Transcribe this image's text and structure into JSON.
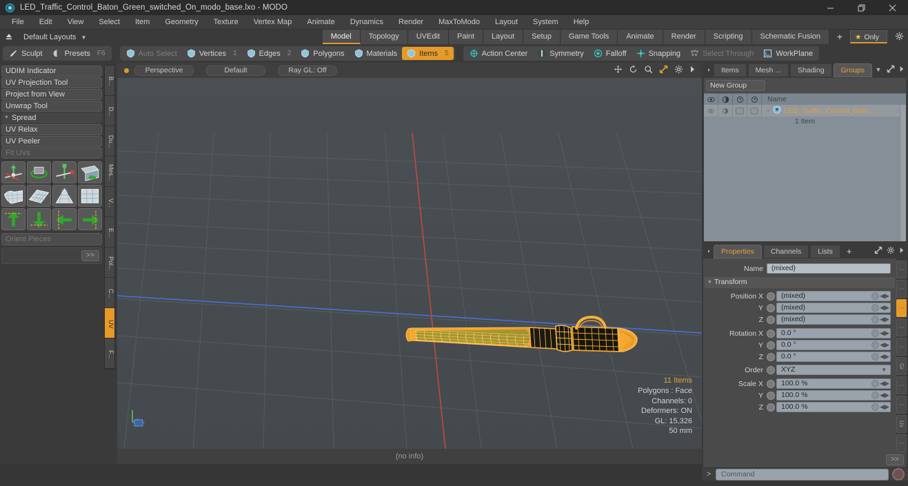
{
  "window": {
    "title": "LED_Traffic_Control_Baton_Green_switched_On_modo_base.lxo - MODO",
    "minimize": "—",
    "maximize": "❐",
    "close": "✕"
  },
  "menubar": [
    "File",
    "Edit",
    "View",
    "Select",
    "Item",
    "Geometry",
    "Texture",
    "Vertex Map",
    "Animate",
    "Dynamics",
    "Render",
    "MaxToModo",
    "Layout",
    "System",
    "Help"
  ],
  "layoutbar": {
    "layouts_label": "Default Layouts",
    "tabs": [
      "Model",
      "Topology",
      "UVEdit",
      "Paint",
      "Layout",
      "Setup",
      "Game Tools",
      "Animate",
      "Render",
      "Scripting",
      "Schematic Fusion"
    ],
    "selected_tab": "Model",
    "plus": "+",
    "only_label": "Only",
    "star": "★"
  },
  "modebar": {
    "group1": [
      {
        "label": "Sculpt",
        "icon": "brush-icon",
        "state": "normal",
        "num": ""
      },
      {
        "label": "Presets",
        "icon": "sphere-icon",
        "state": "normal",
        "num": "F6"
      }
    ],
    "group2": [
      {
        "label": "Auto Select",
        "icon": "shield-icon",
        "state": "dim",
        "num": ""
      },
      {
        "label": "Vertices",
        "icon": "shield-icon",
        "state": "normal",
        "num": "1"
      },
      {
        "label": "Edges",
        "icon": "shield-icon",
        "state": "normal",
        "num": "2"
      },
      {
        "label": "Polygons",
        "icon": "shield-icon",
        "state": "normal",
        "num": ""
      },
      {
        "label": "Materials",
        "icon": "shield-icon",
        "state": "normal",
        "num": ""
      },
      {
        "label": "Items",
        "icon": "shield-icon",
        "state": "on",
        "num": "5"
      }
    ],
    "group3": [
      {
        "label": "Action Center",
        "icon": "target-icon",
        "state": "normal",
        "num": ""
      },
      {
        "label": "Symmetry",
        "icon": "bars-icon",
        "state": "normal",
        "num": ""
      },
      {
        "label": "Falloff",
        "icon": "circle-icon",
        "state": "normal",
        "num": ""
      },
      {
        "label": "Snapping",
        "icon": "crosshair-icon",
        "state": "normal",
        "num": ""
      },
      {
        "label": "Select Through",
        "icon": "dots-icon",
        "state": "dim",
        "num": ""
      },
      {
        "label": "WorkPlane",
        "icon": "plane-icon",
        "state": "normal",
        "num": ""
      }
    ]
  },
  "left_panel": {
    "rows": [
      {
        "label": "UDIM Indicator",
        "type": "button",
        "state": "normal"
      },
      {
        "label": "UV Projection Tool",
        "type": "button",
        "state": "normal"
      },
      {
        "label": "Project from View",
        "type": "button",
        "state": "normal"
      },
      {
        "label": "Unwrap Tool",
        "type": "button",
        "state": "normal"
      },
      {
        "label": "Spread",
        "type": "group",
        "state": "normal"
      },
      {
        "label": "UV Relax",
        "type": "button",
        "state": "normal"
      },
      {
        "label": "UV Peeler",
        "type": "button",
        "state": "normal"
      },
      {
        "label": "Fit UVs",
        "type": "button",
        "state": "dim"
      }
    ],
    "tool_grid": [
      [
        "uv-move-icon",
        "uv-rotate-icon",
        "uv-scale-icon",
        "uv-flip-icon"
      ],
      [
        "uv-fit-icon",
        "uv-grid-icon",
        "uv-taper-icon",
        "uv-square-icon"
      ],
      [
        "uv-up-icon",
        "uv-down-icon",
        "uv-left-icon",
        "uv-right-icon"
      ]
    ],
    "orient_label": "Orient Pieces",
    "more_label": ">>",
    "vtabs": [
      {
        "label": "B...",
        "on": false
      },
      {
        "label": "D...",
        "on": false
      },
      {
        "label": "Du...",
        "on": false
      },
      {
        "label": "Mes...",
        "on": false
      },
      {
        "label": "V...",
        "on": false
      },
      {
        "label": "E...",
        "on": false
      },
      {
        "label": "Pol...",
        "on": false
      },
      {
        "label": "C...",
        "on": false
      },
      {
        "label": "UV",
        "on": true
      },
      {
        "label": "F...",
        "on": false
      }
    ]
  },
  "viewport": {
    "pills": [
      "Perspective",
      "Default",
      "Ray GL: Off"
    ],
    "nav_icons": [
      "pan-icon",
      "rotate-icon",
      "zoom-icon",
      "fit-icon",
      "settings-icon",
      "more-icon"
    ],
    "info": {
      "items": "11 Items",
      "polygons": "Polygons : Face",
      "channels": "Channels: 0",
      "deformers": "Deformers: ON",
      "gl": "GL: 15,326",
      "scale": "50 mm"
    },
    "status": "(no info)"
  },
  "right_panel": {
    "tabs": [
      {
        "label": "Items",
        "sel": false
      },
      {
        "label": "Mesh ...",
        "sel": false
      },
      {
        "label": "Shading",
        "sel": false
      },
      {
        "label": "Groups",
        "sel": true
      }
    ],
    "tab_caret": "▼",
    "new_group_label": "New Group",
    "list_header": {
      "cols": [
        "eye-icon",
        "shade-icon",
        "lock-icon",
        "render-icon"
      ],
      "name": "Name"
    },
    "list_rows": [
      {
        "name": "LED_Traffic_Control_Bato ...",
        "sub": "1 Item",
        "expander": "+"
      }
    ]
  },
  "properties": {
    "tabs": [
      {
        "label": "Properties",
        "sel": true
      },
      {
        "label": "Channels",
        "sel": false
      },
      {
        "label": "Lists",
        "sel": false
      },
      {
        "label": "+",
        "sel": false
      }
    ],
    "name_label": "Name",
    "name_value": "(mixed)",
    "transform_label": "Transform",
    "fields": [
      {
        "label": "Position X",
        "value": "(mixed)",
        "type": "num"
      },
      {
        "label": "Y",
        "value": "(mixed)",
        "type": "num"
      },
      {
        "label": "Z",
        "value": "(mixed)",
        "type": "num"
      },
      {
        "label": "Rotation X",
        "value": "0.0 °",
        "type": "num"
      },
      {
        "label": "Y",
        "value": "0.0 °",
        "type": "num"
      },
      {
        "label": "Z",
        "value": "0.0 °",
        "type": "num"
      },
      {
        "label": "Order",
        "value": "XYZ",
        "type": "dropdown"
      },
      {
        "label": "Scale X",
        "value": "100.0 %",
        "type": "num"
      },
      {
        "label": "Y",
        "value": "100.0 %",
        "type": "num"
      },
      {
        "label": "Z",
        "value": "100.0 %",
        "type": "num"
      }
    ],
    "more_label": ">>",
    "vtabs": [
      {
        "label": "",
        "on": false
      },
      {
        "label": "",
        "on": false
      },
      {
        "label": "",
        "on": true
      },
      {
        "label": "",
        "on": false
      },
      {
        "label": "",
        "on": false
      },
      {
        "label": "Gr",
        "on": false
      },
      {
        "label": "",
        "on": false
      },
      {
        "label": "",
        "on": false
      },
      {
        "label": "Us",
        "on": false
      },
      {
        "label": "",
        "on": false
      }
    ]
  },
  "command_bar": {
    "prompt": ">",
    "placeholder": "Command",
    "record_icon": "record-icon"
  }
}
